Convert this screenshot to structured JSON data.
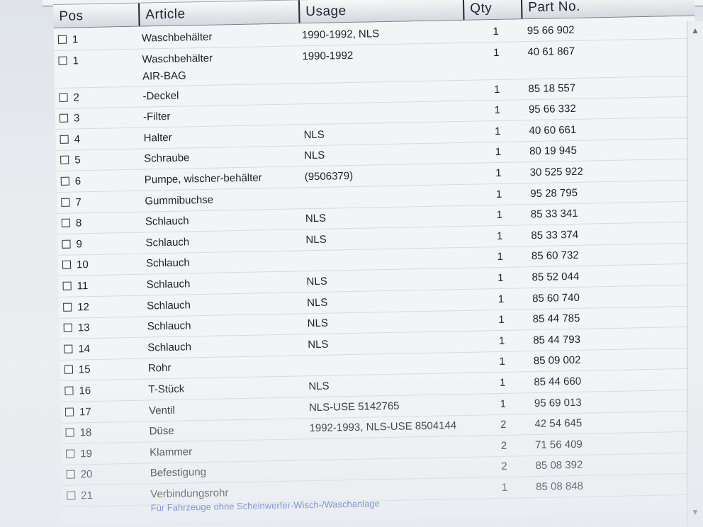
{
  "columns": {
    "pos": "Pos",
    "article": "Article",
    "usage": "Usage",
    "qty": "Qty",
    "part_no": "Part No."
  },
  "rows": [
    {
      "pos": "1",
      "article": "Waschbehälter",
      "usage": "1990-1992, NLS",
      "qty": "1",
      "part_no": "95 66 902",
      "subtext": ""
    },
    {
      "pos": "1",
      "article": "Waschbehälter",
      "usage": "1990-1992",
      "qty": "1",
      "part_no": "40 61 867",
      "subtext": "AIR-BAG"
    },
    {
      "pos": "2",
      "article": "-Deckel",
      "usage": "",
      "qty": "1",
      "part_no": "85 18 557",
      "subtext": ""
    },
    {
      "pos": "3",
      "article": "-Filter",
      "usage": "",
      "qty": "1",
      "part_no": "95 66 332",
      "subtext": ""
    },
    {
      "pos": "4",
      "article": "Halter",
      "usage": "NLS",
      "qty": "1",
      "part_no": "40 60 661",
      "subtext": ""
    },
    {
      "pos": "5",
      "article": "Schraube",
      "usage": "NLS",
      "qty": "1",
      "part_no": "80 19 945",
      "subtext": ""
    },
    {
      "pos": "6",
      "article": "Pumpe, wischer-behälter",
      "usage": "(9506379)",
      "qty": "1",
      "part_no": "30 525 922",
      "subtext": ""
    },
    {
      "pos": "7",
      "article": "Gummibuchse",
      "usage": "",
      "qty": "1",
      "part_no": "95 28 795",
      "subtext": ""
    },
    {
      "pos": "8",
      "article": "Schlauch",
      "usage": "NLS",
      "qty": "1",
      "part_no": "85 33 341",
      "subtext": ""
    },
    {
      "pos": "9",
      "article": "Schlauch",
      "usage": "NLS",
      "qty": "1",
      "part_no": "85 33 374",
      "subtext": ""
    },
    {
      "pos": "10",
      "article": "Schlauch",
      "usage": "",
      "qty": "1",
      "part_no": "85 60 732",
      "subtext": ""
    },
    {
      "pos": "11",
      "article": "Schlauch",
      "usage": "NLS",
      "qty": "1",
      "part_no": "85 52 044",
      "subtext": ""
    },
    {
      "pos": "12",
      "article": "Schlauch",
      "usage": "NLS",
      "qty": "1",
      "part_no": "85 60 740",
      "subtext": ""
    },
    {
      "pos": "13",
      "article": "Schlauch",
      "usage": "NLS",
      "qty": "1",
      "part_no": "85 44 785",
      "subtext": ""
    },
    {
      "pos": "14",
      "article": "Schlauch",
      "usage": "NLS",
      "qty": "1",
      "part_no": "85 44 793",
      "subtext": ""
    },
    {
      "pos": "15",
      "article": "Rohr",
      "usage": "",
      "qty": "1",
      "part_no": "85 09 002",
      "subtext": ""
    },
    {
      "pos": "16",
      "article": "T-Stück",
      "usage": "NLS",
      "qty": "1",
      "part_no": "85 44 660",
      "subtext": ""
    },
    {
      "pos": "17",
      "article": "Ventil",
      "usage": "NLS-USE 5142765",
      "qty": "1",
      "part_no": "95 69 013",
      "subtext": ""
    },
    {
      "pos": "18",
      "article": "Düse",
      "usage": "1992-1993, NLS-USE 8504144",
      "qty": "2",
      "part_no": "42 54 645",
      "subtext": ""
    },
    {
      "pos": "19",
      "article": "Klammer",
      "usage": "",
      "qty": "2",
      "part_no": "71 56 409",
      "subtext": ""
    },
    {
      "pos": "20",
      "article": "Befestigung",
      "usage": "",
      "qty": "2",
      "part_no": "85 08 392",
      "subtext": ""
    },
    {
      "pos": "21",
      "article": "Verbindungsrohr",
      "usage": "",
      "qty": "1",
      "part_no": "85 08 848",
      "subtext": ""
    }
  ],
  "footnote": "Für Fahrzeuge ohne Scheinwerfer-Wisch-/Waschanlage",
  "icons": {
    "checkbox": "checkbox-icon",
    "scroll_up": "chevron-up-icon",
    "scroll_down": "chevron-down-icon"
  },
  "colors": {
    "header_text": "#1d2533",
    "footnote_text": "#2a48c8"
  }
}
